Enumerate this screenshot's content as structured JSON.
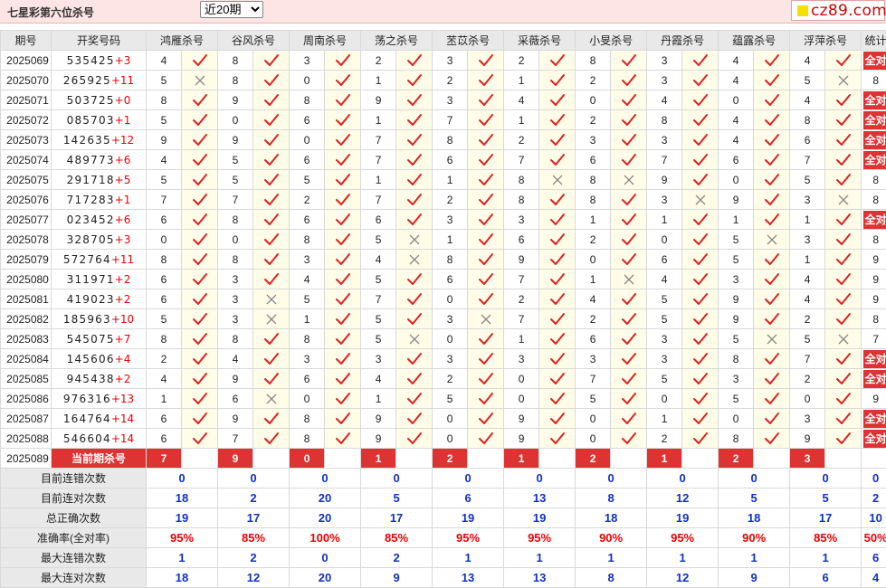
{
  "header": {
    "title": "七星彩第六位杀号",
    "period_selected": "近20期",
    "period_options": [
      "近20期"
    ],
    "site": "cz89.com"
  },
  "colors": {
    "right": "#e02020",
    "wrong": "#888888",
    "badge": "#d33333",
    "value": "#1030c8",
    "percent": "#e00000"
  },
  "columns": [
    "期号",
    "开奖号码",
    "鸿雁杀号",
    "谷风杀号",
    "周南杀号",
    "荡之杀号",
    "苤苡杀号",
    "采薇杀号",
    "小旻杀号",
    "丹霞杀号",
    "蕴露杀号",
    "浮萍杀号",
    "统计"
  ],
  "all_right_label": "全对",
  "rows": [
    {
      "issue": "2025069",
      "draw": "535425",
      "sum": "+3",
      "kills": [
        [
          4,
          1
        ],
        [
          8,
          1
        ],
        [
          3,
          1
        ],
        [
          2,
          1
        ],
        [
          3,
          1
        ],
        [
          2,
          1
        ],
        [
          8,
          1
        ],
        [
          3,
          1
        ],
        [
          4,
          1
        ],
        [
          4,
          1
        ]
      ],
      "stat": "全对"
    },
    {
      "issue": "2025070",
      "draw": "265925",
      "sum": "+11",
      "kills": [
        [
          5,
          0
        ],
        [
          8,
          1
        ],
        [
          0,
          1
        ],
        [
          1,
          1
        ],
        [
          2,
          1
        ],
        [
          1,
          1
        ],
        [
          2,
          1
        ],
        [
          3,
          1
        ],
        [
          4,
          1
        ],
        [
          5,
          0
        ]
      ],
      "stat": "8"
    },
    {
      "issue": "2025071",
      "draw": "503725",
      "sum": "+0",
      "kills": [
        [
          8,
          1
        ],
        [
          9,
          1
        ],
        [
          8,
          1
        ],
        [
          9,
          1
        ],
        [
          3,
          1
        ],
        [
          4,
          1
        ],
        [
          0,
          1
        ],
        [
          4,
          1
        ],
        [
          0,
          1
        ],
        [
          4,
          1
        ]
      ],
      "stat": "全对"
    },
    {
      "issue": "2025072",
      "draw": "085703",
      "sum": "+1",
      "kills": [
        [
          5,
          1
        ],
        [
          0,
          1
        ],
        [
          6,
          1
        ],
        [
          1,
          1
        ],
        [
          7,
          1
        ],
        [
          1,
          1
        ],
        [
          2,
          1
        ],
        [
          8,
          1
        ],
        [
          4,
          1
        ],
        [
          8,
          1
        ]
      ],
      "stat": "全对"
    },
    {
      "issue": "2025073",
      "draw": "142635",
      "sum": "+12",
      "kills": [
        [
          9,
          1
        ],
        [
          9,
          1
        ],
        [
          0,
          1
        ],
        [
          7,
          1
        ],
        [
          8,
          1
        ],
        [
          2,
          1
        ],
        [
          3,
          1
        ],
        [
          3,
          1
        ],
        [
          4,
          1
        ],
        [
          6,
          1
        ]
      ],
      "stat": "全对"
    },
    {
      "issue": "2025074",
      "draw": "489773",
      "sum": "+6",
      "kills": [
        [
          4,
          1
        ],
        [
          5,
          1
        ],
        [
          6,
          1
        ],
        [
          7,
          1
        ],
        [
          6,
          1
        ],
        [
          7,
          1
        ],
        [
          6,
          1
        ],
        [
          7,
          1
        ],
        [
          6,
          1
        ],
        [
          7,
          1
        ]
      ],
      "stat": "全对"
    },
    {
      "issue": "2025075",
      "draw": "291718",
      "sum": "+5",
      "kills": [
        [
          5,
          1
        ],
        [
          5,
          1
        ],
        [
          5,
          1
        ],
        [
          1,
          1
        ],
        [
          1,
          1
        ],
        [
          8,
          0
        ],
        [
          8,
          0
        ],
        [
          9,
          1
        ],
        [
          0,
          1
        ],
        [
          5,
          1
        ]
      ],
      "stat": "8"
    },
    {
      "issue": "2025076",
      "draw": "717283",
      "sum": "+1",
      "kills": [
        [
          7,
          1
        ],
        [
          7,
          1
        ],
        [
          2,
          1
        ],
        [
          7,
          1
        ],
        [
          2,
          1
        ],
        [
          8,
          1
        ],
        [
          8,
          1
        ],
        [
          3,
          0
        ],
        [
          9,
          1
        ],
        [
          3,
          0
        ]
      ],
      "stat": "8"
    },
    {
      "issue": "2025077",
      "draw": "023452",
      "sum": "+6",
      "kills": [
        [
          6,
          1
        ],
        [
          8,
          1
        ],
        [
          6,
          1
        ],
        [
          6,
          1
        ],
        [
          3,
          1
        ],
        [
          3,
          1
        ],
        [
          1,
          1
        ],
        [
          1,
          1
        ],
        [
          1,
          1
        ],
        [
          1,
          1
        ]
      ],
      "stat": "全对"
    },
    {
      "issue": "2025078",
      "draw": "328705",
      "sum": "+3",
      "kills": [
        [
          0,
          1
        ],
        [
          0,
          1
        ],
        [
          8,
          1
        ],
        [
          5,
          0
        ],
        [
          1,
          1
        ],
        [
          6,
          1
        ],
        [
          2,
          1
        ],
        [
          0,
          1
        ],
        [
          5,
          0
        ],
        [
          3,
          1
        ]
      ],
      "stat": "8"
    },
    {
      "issue": "2025079",
      "draw": "572764",
      "sum": "+11",
      "kills": [
        [
          8,
          1
        ],
        [
          8,
          1
        ],
        [
          3,
          1
        ],
        [
          4,
          0
        ],
        [
          8,
          1
        ],
        [
          9,
          1
        ],
        [
          0,
          1
        ],
        [
          6,
          1
        ],
        [
          5,
          1
        ],
        [
          1,
          1
        ]
      ],
      "stat": "9"
    },
    {
      "issue": "2025080",
      "draw": "311971",
      "sum": "+2",
      "kills": [
        [
          6,
          1
        ],
        [
          3,
          1
        ],
        [
          4,
          1
        ],
        [
          5,
          1
        ],
        [
          6,
          1
        ],
        [
          7,
          1
        ],
        [
          1,
          0
        ],
        [
          4,
          1
        ],
        [
          3,
          1
        ],
        [
          4,
          1
        ]
      ],
      "stat": "9"
    },
    {
      "issue": "2025081",
      "draw": "419023",
      "sum": "+2",
      "kills": [
        [
          6,
          1
        ],
        [
          3,
          0
        ],
        [
          5,
          1
        ],
        [
          7,
          1
        ],
        [
          0,
          1
        ],
        [
          2,
          1
        ],
        [
          4,
          1
        ],
        [
          5,
          1
        ],
        [
          9,
          1
        ],
        [
          4,
          1
        ]
      ],
      "stat": "9"
    },
    {
      "issue": "2025082",
      "draw": "185963",
      "sum": "+10",
      "kills": [
        [
          5,
          1
        ],
        [
          3,
          0
        ],
        [
          1,
          1
        ],
        [
          5,
          1
        ],
        [
          3,
          0
        ],
        [
          7,
          1
        ],
        [
          2,
          1
        ],
        [
          5,
          1
        ],
        [
          9,
          1
        ],
        [
          2,
          1
        ]
      ],
      "stat": "8"
    },
    {
      "issue": "2025083",
      "draw": "545075",
      "sum": "+7",
      "kills": [
        [
          8,
          1
        ],
        [
          8,
          1
        ],
        [
          8,
          1
        ],
        [
          5,
          0
        ],
        [
          0,
          1
        ],
        [
          1,
          1
        ],
        [
          6,
          1
        ],
        [
          3,
          1
        ],
        [
          5,
          0
        ],
        [
          5,
          0
        ]
      ],
      "stat": "7"
    },
    {
      "issue": "2025084",
      "draw": "145606",
      "sum": "+4",
      "kills": [
        [
          2,
          1
        ],
        [
          4,
          1
        ],
        [
          3,
          1
        ],
        [
          3,
          1
        ],
        [
          3,
          1
        ],
        [
          3,
          1
        ],
        [
          3,
          1
        ],
        [
          3,
          1
        ],
        [
          8,
          1
        ],
        [
          7,
          1
        ]
      ],
      "stat": "全对"
    },
    {
      "issue": "2025085",
      "draw": "945438",
      "sum": "+2",
      "kills": [
        [
          4,
          1
        ],
        [
          9,
          1
        ],
        [
          6,
          1
        ],
        [
          4,
          1
        ],
        [
          2,
          1
        ],
        [
          0,
          1
        ],
        [
          7,
          1
        ],
        [
          5,
          1
        ],
        [
          3,
          1
        ],
        [
          2,
          1
        ]
      ],
      "stat": "全对"
    },
    {
      "issue": "2025086",
      "draw": "976316",
      "sum": "+13",
      "kills": [
        [
          1,
          1
        ],
        [
          6,
          0
        ],
        [
          0,
          1
        ],
        [
          1,
          1
        ],
        [
          5,
          1
        ],
        [
          0,
          1
        ],
        [
          5,
          1
        ],
        [
          0,
          1
        ],
        [
          5,
          1
        ],
        [
          0,
          1
        ]
      ],
      "stat": "9"
    },
    {
      "issue": "2025087",
      "draw": "164764",
      "sum": "+14",
      "kills": [
        [
          6,
          1
        ],
        [
          9,
          1
        ],
        [
          8,
          1
        ],
        [
          9,
          1
        ],
        [
          0,
          1
        ],
        [
          9,
          1
        ],
        [
          0,
          1
        ],
        [
          1,
          1
        ],
        [
          0,
          1
        ],
        [
          3,
          1
        ]
      ],
      "stat": "全对"
    },
    {
      "issue": "2025088",
      "draw": "546604",
      "sum": "+14",
      "kills": [
        [
          6,
          1
        ],
        [
          7,
          1
        ],
        [
          8,
          1
        ],
        [
          9,
          1
        ],
        [
          0,
          1
        ],
        [
          9,
          1
        ],
        [
          0,
          1
        ],
        [
          2,
          1
        ],
        [
          8,
          1
        ],
        [
          9,
          1
        ]
      ],
      "stat": "全对"
    }
  ],
  "current": {
    "issue": "2025089",
    "label": "当前期杀号",
    "kills": [
      7,
      9,
      0,
      1,
      2,
      1,
      2,
      1,
      2,
      3
    ]
  },
  "summary": [
    {
      "label": "目前连错次数",
      "values": [
        "0",
        "0",
        "0",
        "0",
        "0",
        "0",
        "0",
        "0",
        "0",
        "0",
        "0"
      ],
      "pct": false
    },
    {
      "label": "目前连对次数",
      "values": [
        "18",
        "2",
        "20",
        "5",
        "6",
        "13",
        "8",
        "12",
        "5",
        "5",
        "2"
      ],
      "pct": false
    },
    {
      "label": "总正确次数",
      "values": [
        "19",
        "17",
        "20",
        "17",
        "19",
        "19",
        "18",
        "19",
        "18",
        "17",
        "10"
      ],
      "pct": false
    },
    {
      "label": "准确率(全对率)",
      "values": [
        "95%",
        "85%",
        "100%",
        "85%",
        "95%",
        "95%",
        "90%",
        "95%",
        "90%",
        "85%",
        "50%"
      ],
      "pct": true
    },
    {
      "label": "最大连错次数",
      "values": [
        "1",
        "2",
        "0",
        "2",
        "1",
        "1",
        "1",
        "1",
        "1",
        "1",
        "6"
      ],
      "pct": false
    },
    {
      "label": "最大连对次数",
      "values": [
        "18",
        "12",
        "20",
        "9",
        "13",
        "13",
        "8",
        "12",
        "9",
        "6",
        "4"
      ],
      "pct": false
    }
  ]
}
